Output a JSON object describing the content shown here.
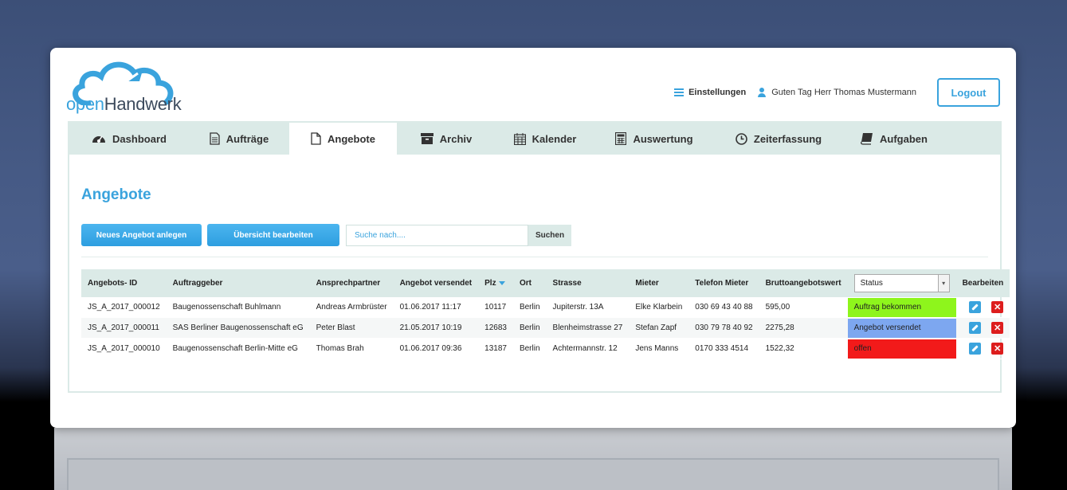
{
  "brand": {
    "logo_a": "open",
    "logo_b": "Handwerk"
  },
  "topbar": {
    "settings_label": "Einstellungen",
    "greeting": "Guten Tag Herr Thomas Mustermann",
    "logout_label": "Logout"
  },
  "tabs": [
    {
      "label": "Dashboard",
      "icon": "dashboard-icon"
    },
    {
      "label": "Aufträge",
      "icon": "document-text-icon"
    },
    {
      "label": "Angebote",
      "icon": "document-icon",
      "active": true
    },
    {
      "label": "Archiv",
      "icon": "archive-icon"
    },
    {
      "label": "Kalender",
      "icon": "calendar-icon"
    },
    {
      "label": "Auswertung",
      "icon": "calculator-icon"
    },
    {
      "label": "Zeiterfassung",
      "icon": "clock-icon"
    },
    {
      "label": "Aufgaben",
      "icon": "book-icon"
    }
  ],
  "page": {
    "title": "Angebote",
    "new_button": "Neues Angebot anlegen",
    "overview_button": "Übersicht bearbeiten",
    "search_placeholder": "Suche nach....",
    "search_button": "Suchen"
  },
  "table": {
    "headers": {
      "id": "Angebots- ID",
      "client": "Auftraggeber",
      "contact": "Ansprechpartner",
      "sent": "Angebot versendet",
      "zip": "Plz",
      "city": "Ort",
      "street": "Strasse",
      "tenant": "Mieter",
      "phone": "Telefon Mieter",
      "gross": "Bruttoangebotswert",
      "status": "Status",
      "edit": "Bearbeiten"
    },
    "rows": [
      {
        "id": "JS_A_2017_000012",
        "client": "Baugenossenschaft Buhlmann",
        "contact": "Andreas Armbrüster",
        "sent": "01.06.2017 11:17",
        "zip": "10117",
        "city": "Berlin",
        "street": "Jupiterstr. 13A",
        "tenant": "Elke Klarbein",
        "phone": "030 69 43 40 88",
        "gross": "595,00",
        "status": "Auftrag bekommen",
        "status_color": "#8ef51c"
      },
      {
        "id": "JS_A_2017_000011",
        "client": "SAS Berliner Baugenossenschaft eG",
        "contact": "Peter Blast",
        "sent": "21.05.2017 10:19",
        "zip": "12683",
        "city": "Berlin",
        "street": "Blenheimstrasse 27",
        "tenant": "Stefan Zapf",
        "phone": "030 79 78 40 92",
        "gross": "2275,28",
        "status": "Angebot versendet",
        "status_color": "#7da7f0"
      },
      {
        "id": "JS_A_2017_000010",
        "client": "Baugenossenschaft Berlin-Mitte eG",
        "contact": "Thomas Brah",
        "sent": "01.06.2017 09:36",
        "zip": "13187",
        "city": "Berlin",
        "street": "Achtermannstr. 12",
        "tenant": "Jens Manns",
        "phone": "0170 333 4514",
        "gross": "1522,32",
        "status": "offen",
        "status_color": "#f21a1a"
      }
    ]
  }
}
